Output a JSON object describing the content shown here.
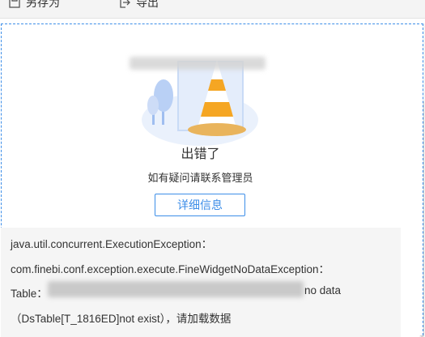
{
  "toolbar": {
    "save_as": "另存为",
    "export": "导出"
  },
  "error": {
    "title": "出错了",
    "subtitle": "如有疑问请联系管理员",
    "detail_button": "详细信息"
  },
  "details": {
    "line1": "java.util.concurrent.ExecutionException：",
    "line2": "com.finebi.conf.exception.execute.FineWidgetNoDataException：",
    "line3_prefix": "Table：",
    "line3_suffix": "no data",
    "line4": "（DsTable[T_1816ED]not exist），请加载数据"
  },
  "colors": {
    "accent": "#3d8ee8",
    "cone_orange": "#f5a623",
    "illus_blue": "#dbe8fb"
  }
}
